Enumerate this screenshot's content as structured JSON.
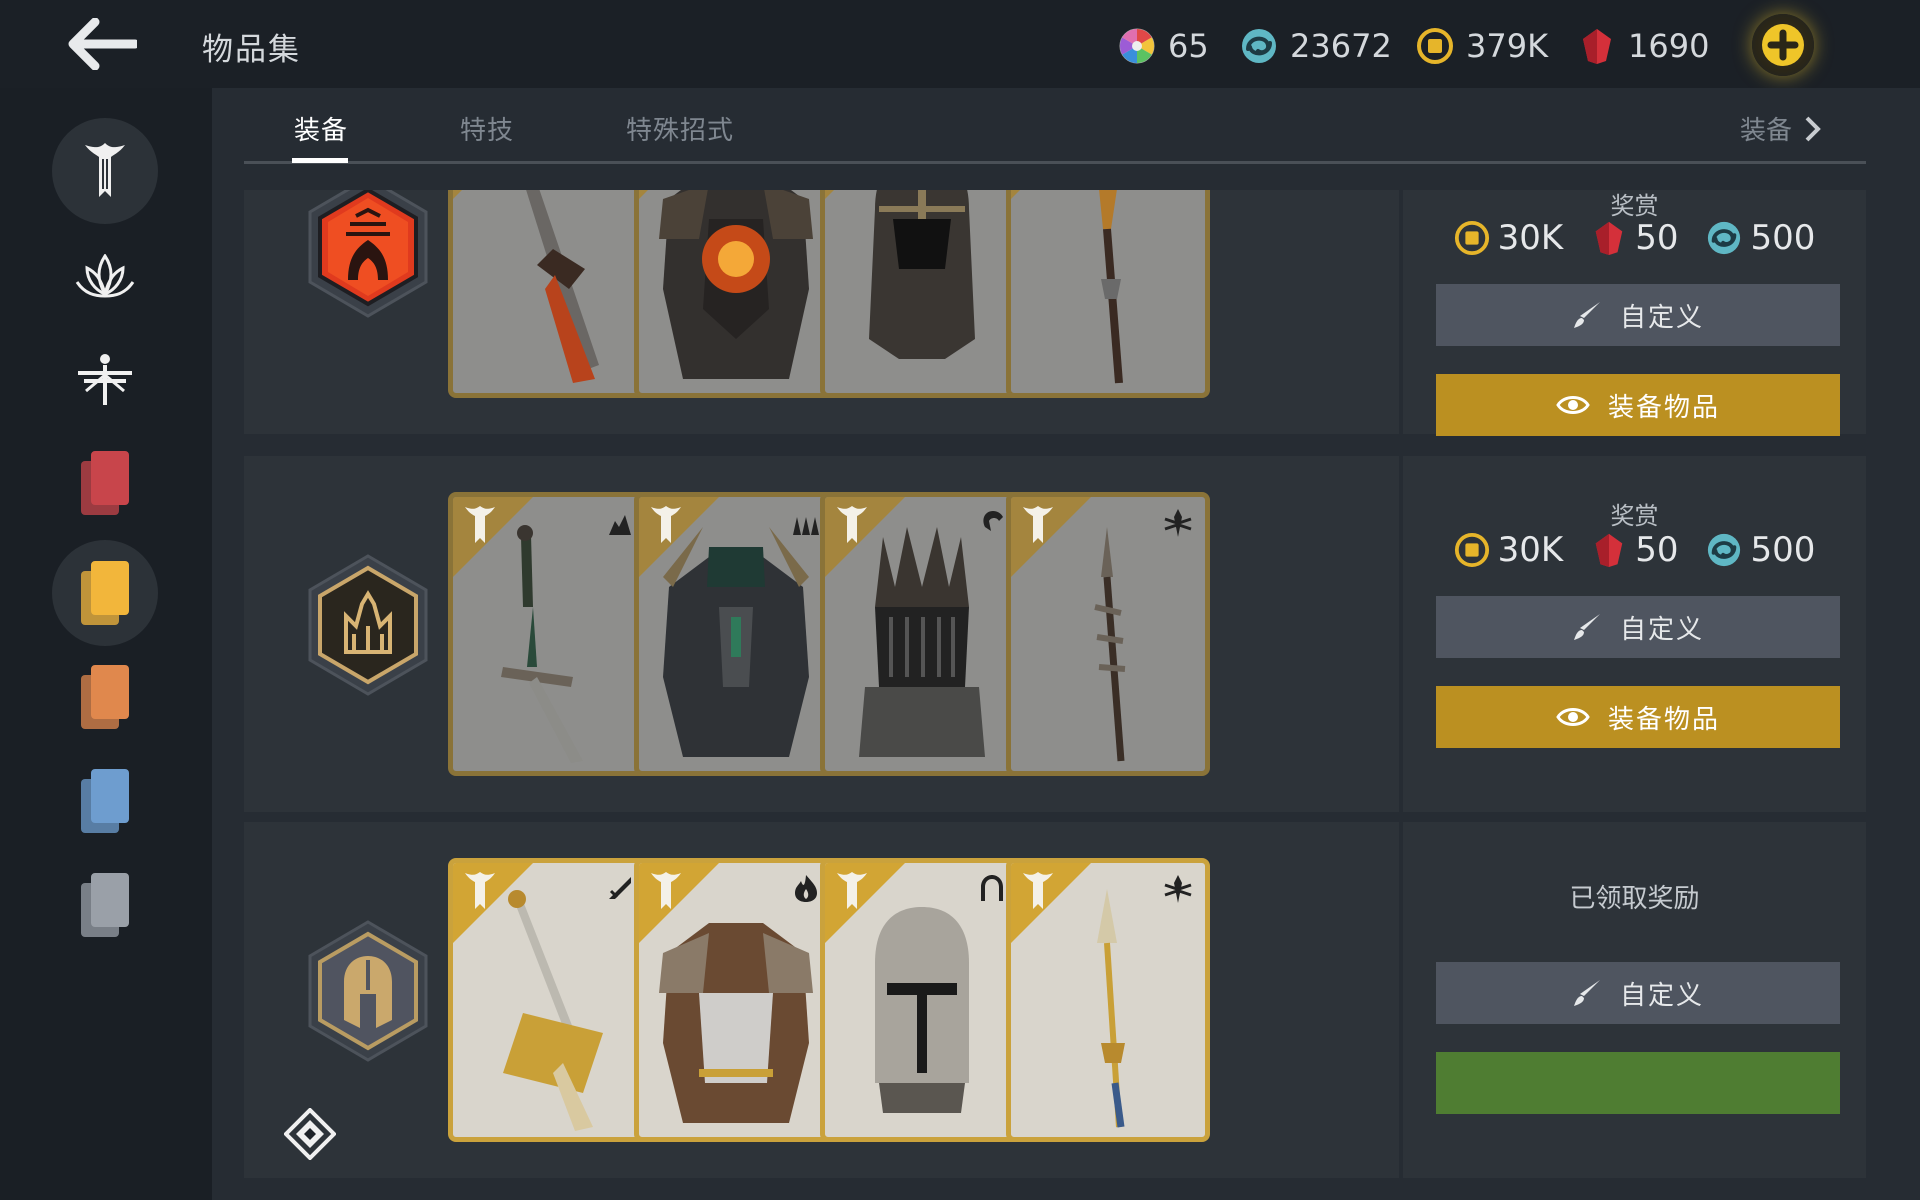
{
  "header": {
    "title": "物品集",
    "currencies": [
      {
        "icon": "color-wheel-icon",
        "value": "65"
      },
      {
        "icon": "steel-swirl-icon",
        "value": "23672"
      },
      {
        "icon": "gold-coin-icon",
        "value": "379K"
      },
      {
        "icon": "red-gem-icon",
        "value": "1690"
      }
    ]
  },
  "sidebar": {
    "items": [
      {
        "name": "hero-class-icon",
        "active": true
      },
      {
        "name": "lotus-faction-icon",
        "active": false
      },
      {
        "name": "dragonfly-faction-icon",
        "active": false
      },
      {
        "name": "red-cards-icon",
        "color": "#c8454b",
        "active": false
      },
      {
        "name": "yellow-cards-icon",
        "color": "#f2b63b",
        "active": true
      },
      {
        "name": "orange-cards-icon",
        "color": "#e0884d",
        "active": false
      },
      {
        "name": "blue-cards-icon",
        "color": "#6e9dcf",
        "active": false
      },
      {
        "name": "gray-cards-icon",
        "color": "#9aa0a8",
        "active": false
      }
    ]
  },
  "tabs": {
    "items": [
      "装备",
      "特技",
      "特殊招式"
    ],
    "active": 0,
    "right_label": "装备"
  },
  "rows": [
    {
      "badge": "flame-crown-badge",
      "reward_label": "奖赏",
      "rewards": {
        "coins": "30K",
        "gems": "50",
        "steel": "500"
      },
      "customize_label": "自定义",
      "equip_label": "装备物品",
      "claimed": false,
      "items": [
        {
          "name": "flame-greatsword",
          "type_icon": "greatsword-type-icon"
        },
        {
          "name": "molten-chest-armor",
          "type_icon": "chest-type-icon"
        },
        {
          "name": "dark-helm",
          "type_icon": "helm-type-icon"
        },
        {
          "name": "fire-spear",
          "type_icon": "spear-type-icon"
        }
      ]
    },
    {
      "badge": "iron-crown-badge",
      "reward_label": "奖赏",
      "rewards": {
        "coins": "30K",
        "gems": "50",
        "steel": "500"
      },
      "customize_label": "自定义",
      "equip_label": "装备物品",
      "claimed": false,
      "items": [
        {
          "name": "jade-longsword",
          "type_icon": "longsword-type-icon"
        },
        {
          "name": "warlord-chest-armor",
          "type_icon": "chest-type-icon"
        },
        {
          "name": "spiked-helm",
          "type_icon": "helm-type-icon"
        },
        {
          "name": "barbed-spear",
          "type_icon": "spear-type-icon"
        }
      ]
    },
    {
      "badge": "knight-helm-badge",
      "claimed_label": "已领取奖励",
      "customize_label": "自定义",
      "claimed": true,
      "items": [
        {
          "name": "gold-greatsword",
          "type_icon": "greatsword-type-icon"
        },
        {
          "name": "leather-plate-armor",
          "type_icon": "fire-type-icon"
        },
        {
          "name": "knight-helm",
          "type_icon": "horseshoe-type-icon"
        },
        {
          "name": "gold-spear",
          "type_icon": "spear-type-icon"
        }
      ]
    }
  ]
}
